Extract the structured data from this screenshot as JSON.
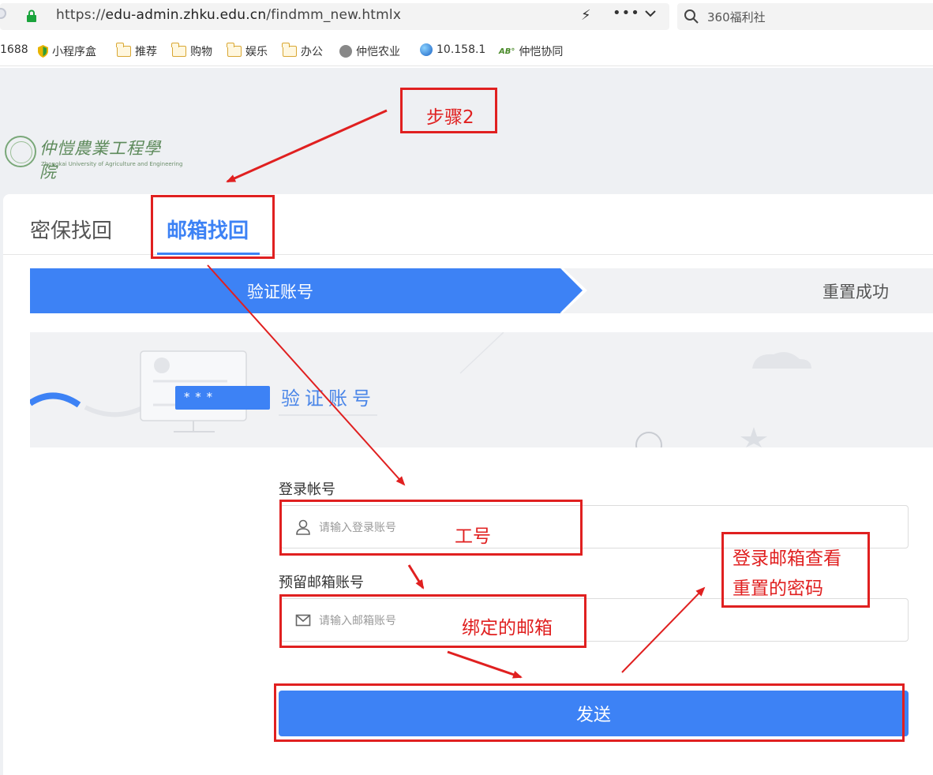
{
  "browser": {
    "url_prefix": "https://",
    "url_host": "edu-admin.zhku.edu.cn",
    "url_path": "/findmm_new.htmlx",
    "search_text": "360福利社",
    "bookmarks": [
      "1688",
      "小程序盒",
      "推荐",
      "购物",
      "娱乐",
      "办公",
      "仲恺农业",
      "10.158.1",
      "仲恺协同"
    ]
  },
  "page": {
    "logo_cn": "仲愷農業工程學院",
    "logo_en": "Zhongkai University of Agriculture and Engineering",
    "tabs": [
      "密保找回",
      "邮箱找回"
    ],
    "steps": [
      "验证账号",
      "重置成功"
    ],
    "banner_title": "验证账号",
    "banner_stars": "* * *",
    "login_label": "登录帐号",
    "login_placeholder": "请输入登录账号",
    "email_label": "预留邮箱账号",
    "email_placeholder": "请输入邮箱账号",
    "send_label": "发送"
  },
  "annotations": {
    "step2": "步骤2",
    "employee_id": "工号",
    "bound_email": "绑定的邮箱",
    "check_email_line1": "登录邮箱查看",
    "check_email_line2": "重置的密码"
  },
  "colors": {
    "accent": "#3d82f5",
    "annotation": "#e02020"
  }
}
